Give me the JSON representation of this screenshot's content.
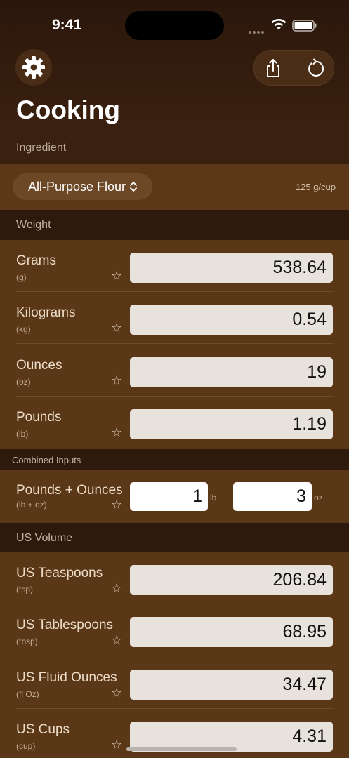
{
  "status": {
    "time": "9:41"
  },
  "header": {
    "title": "Cooking",
    "ingredient_label": "Ingredient",
    "ingredient_selected": "All-Purpose Flour",
    "density": "125 g/cup"
  },
  "sections": {
    "weight": "Weight",
    "combined": "Combined Inputs",
    "us_volume": "US Volume"
  },
  "weight_rows": [
    {
      "name": "Grams",
      "abbr": "(g)",
      "value": "538.64"
    },
    {
      "name": "Kilograms",
      "abbr": "(kg)",
      "value": "0.54"
    },
    {
      "name": "Ounces",
      "abbr": "(oz)",
      "value": "19"
    },
    {
      "name": "Pounds",
      "abbr": "(lb)",
      "value": "1.19"
    }
  ],
  "combined_row": {
    "name": "Pounds + Ounces",
    "abbr": "(lb + oz)",
    "pounds_value": "1",
    "pounds_unit": "lb",
    "ounces_value": "3",
    "ounces_unit": "oz"
  },
  "volume_rows": [
    {
      "name": "US Teaspoons",
      "abbr": "(tsp)",
      "value": "206.84"
    },
    {
      "name": "US Tablespoons",
      "abbr": "(tbsp)",
      "value": "68.95"
    },
    {
      "name": "US Fluid Ounces",
      "abbr": "(fl Oz)",
      "value": "34.47"
    },
    {
      "name": "US Cups",
      "abbr": "(cup)",
      "value": "4.31"
    }
  ],
  "icons": {
    "star": "☆",
    "chevron": "⌃⌄"
  },
  "colors": {
    "background": "#3a200f",
    "row_background": "#5a3716",
    "section_background": "#2d1a0c",
    "field_background": "#e8e2dd"
  }
}
